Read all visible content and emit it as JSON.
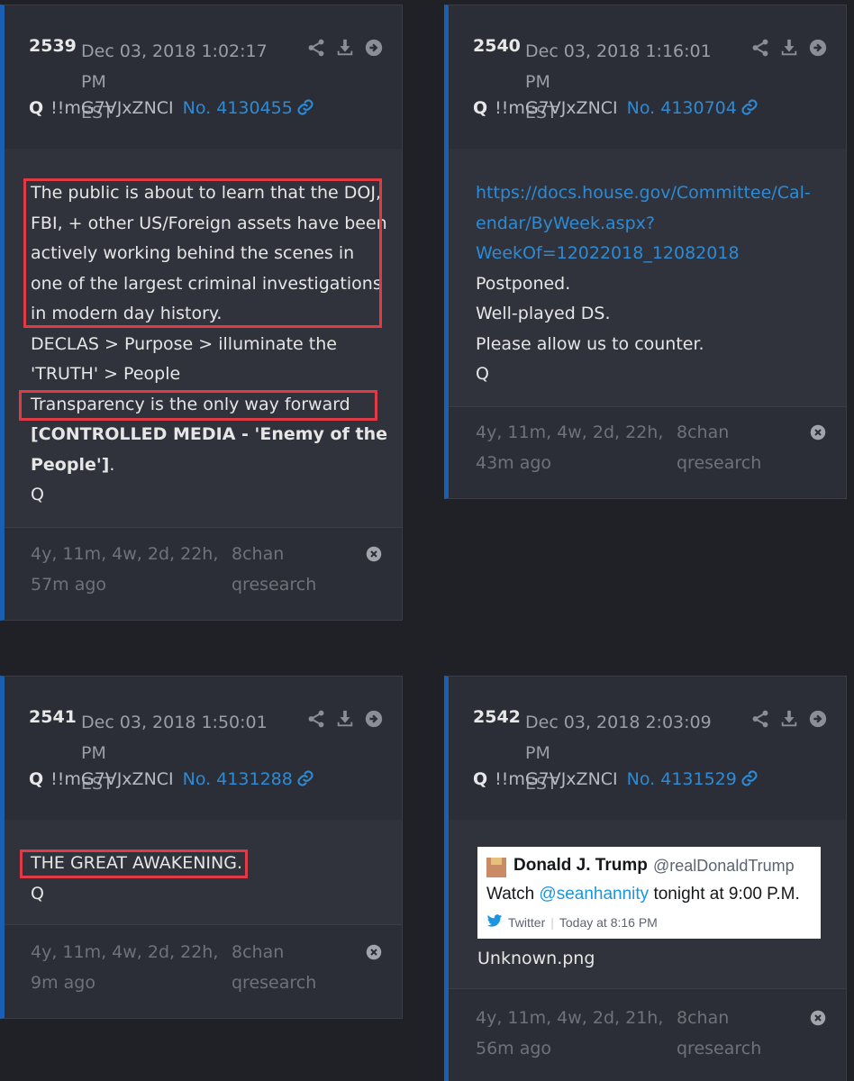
{
  "posts": [
    {
      "number": "2539",
      "date": "Dec 03, 2018 1:02:17 PM",
      "tz": "EST",
      "trip_q": "Q",
      "tripcode": "!!mG7VJxZNCI",
      "post_no": "No. 4130455",
      "lines": [
        "The public is about to learn that the DOJ,",
        "FBI, + other US/Foreign assets have been",
        "actively working behind the scenes in",
        "one of the largest criminal investigations",
        "in modern day history.",
        "DECLAS > Purpose > illuminate the",
        "'TRUTH' > People",
        "Transparency is the only way forward"
      ],
      "bold_line_1": "[CONTROLLED MEDIA - 'Enemy of the",
      "bold_line_2": "People']",
      "bold_suffix": ".",
      "sign": "Q",
      "age_1": "4y, 11m, 4w, 2d, 22h,",
      "age_2": "57m ago",
      "board_1": "8chan",
      "board_2": "qresearch"
    },
    {
      "number": "2540",
      "date": "Dec 03, 2018 1:16:01 PM",
      "tz": "EST",
      "trip_q": "Q",
      "tripcode": "!!mG7VJxZNCI",
      "post_no": "No. 4130704",
      "url_1": "https://docs.house.gov/Committee/Cal-",
      "url_2": "endar/ByWeek.aspx?",
      "url_3": "WeekOf=12022018_12082018",
      "lines": [
        "Postponed.",
        "Well-played DS.",
        "Please allow us to counter.",
        "Q"
      ],
      "age_1": "4y, 11m, 4w, 2d, 22h,",
      "age_2": "43m ago",
      "board_1": "8chan",
      "board_2": "qresearch"
    },
    {
      "number": "2541",
      "date": "Dec 03, 2018 1:50:01 PM",
      "tz": "EST",
      "trip_q": "Q",
      "tripcode": "!!mG7VJxZNCI",
      "post_no": "No. 4131288",
      "lines": [
        "THE GREAT AWAKENING.",
        "Q"
      ],
      "age_1": "4y, 11m, 4w, 2d, 22h,",
      "age_2": "9m ago",
      "board_1": "8chan",
      "board_2": "qresearch"
    },
    {
      "number": "2542",
      "date": "Dec 03, 2018 2:03:09 PM",
      "tz": "EST",
      "trip_q": "Q",
      "tripcode": "!!mG7VJxZNCI",
      "post_no": "No. 4131529",
      "tweet": {
        "name": "Donald J. Trump",
        "handle": "@realDonaldTrump",
        "text_prefix": "Watch ",
        "mention": "@seanhannity",
        "text_suffix": " tonight at 9:00 P.M.",
        "source": "Twitter",
        "sep": "|",
        "time": "Today at 8:16 PM"
      },
      "filename": "Unknown.png",
      "age_1": "4y, 11m, 4w, 2d, 21h,",
      "age_2": "56m ago",
      "board_1": "8chan",
      "board_2": "qresearch"
    }
  ],
  "colors": {
    "page_bg": "#1f2127",
    "card_bg": "#2b2e36",
    "accent": "#1a5fb4",
    "link": "#2d8bd6",
    "highlight": "#e03a45"
  }
}
